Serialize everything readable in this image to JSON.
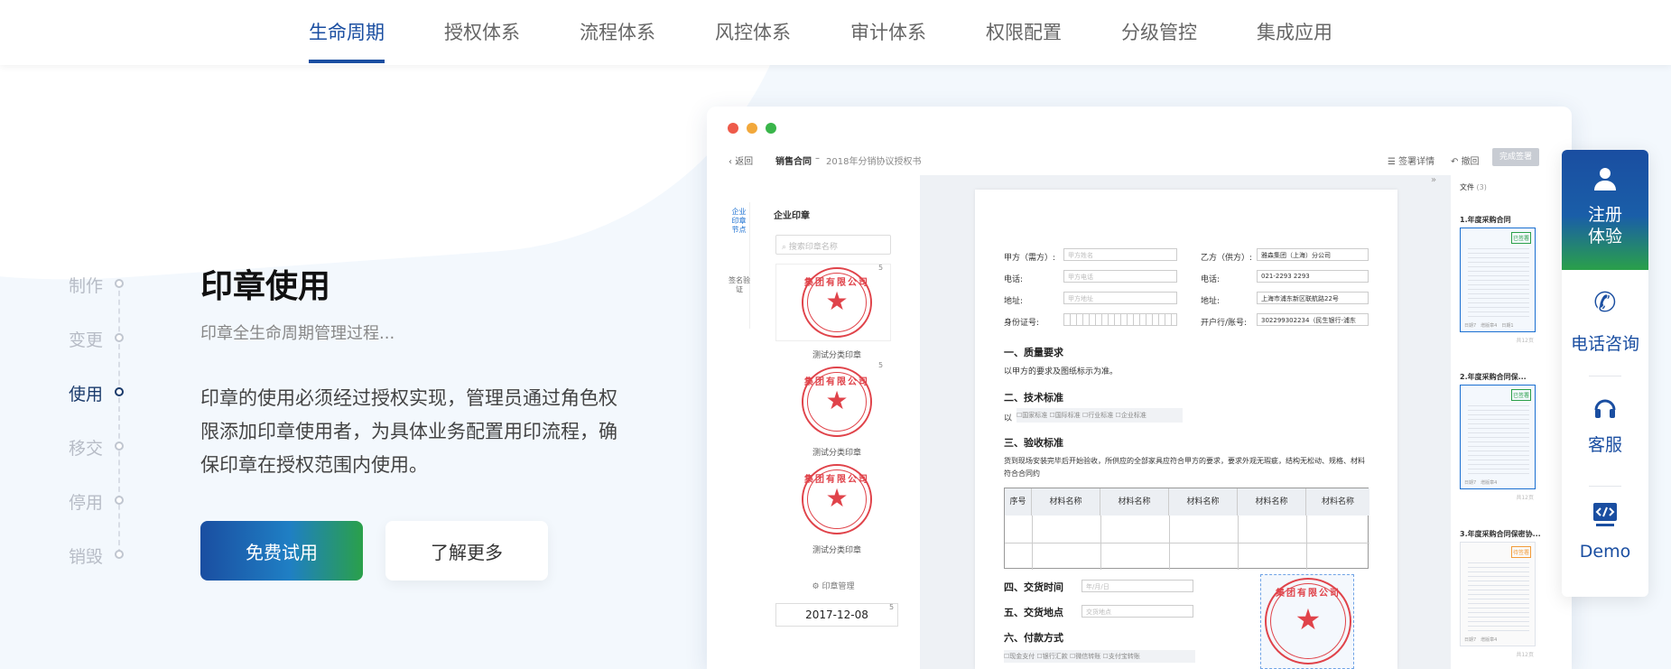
{
  "nav": {
    "tabs": [
      "生命周期",
      "授权体系",
      "流程体系",
      "风控体系",
      "审计体系",
      "权限配置",
      "分级管控",
      "集成应用"
    ],
    "active": 0
  },
  "timeline": [
    "制作",
    "变更",
    "使用",
    "移交",
    "停用",
    "销毁"
  ],
  "timeline_active": 2,
  "hero": {
    "title": "印章使用",
    "subtitle": "印章全生命周期管理过程...",
    "description": "印章的使用必须经过授权实现，管理员通过角色权限添加印章使用者，为具体业务配置用印流程，确保印章在授权范围内使用。",
    "primary_button": "免费试用",
    "secondary_button": "了解更多"
  },
  "app": {
    "back": "返回",
    "breadcrumb_main": "销售合同",
    "breadcrumb_sep": "–",
    "breadcrumb_doc": "2018年分销协议授权书",
    "sign_detail": "签署详情",
    "revoke": "撤回",
    "finish": "完成签署",
    "side_tabs": [
      "企业印章节点",
      "签名验证"
    ],
    "panel_title": "企业印章",
    "search_placeholder": "搜索印章名称",
    "stamp_text": "集团有限公司",
    "stamps": [
      {
        "label": "测试分类印章",
        "count": "5"
      },
      {
        "label": "测试分类印章",
        "count": "5"
      },
      {
        "label": "测试分类印章",
        "count": ""
      }
    ],
    "manage": "印章管理",
    "date": "2017-12-08",
    "date_count": "5",
    "files_title": "文件",
    "files_count": "(3)",
    "files": [
      {
        "name": "1.年度采购合同",
        "badge": "已签署",
        "meta": "日期7　增版章4　日期1",
        "pages": "共12页"
      },
      {
        "name": "2.年度采购合同保...",
        "badge": "已签署",
        "meta": "日期7　增版章4",
        "pages": "共12页"
      },
      {
        "name": "3.年度采购合同保密协...",
        "badge": "待签署",
        "meta": "日期7　增版章4",
        "pages": "共12页"
      }
    ]
  },
  "doc": {
    "party_a": "甲方（需方）:",
    "party_a_ph": "甲方姓名",
    "party_b": "乙方（供方）:",
    "party_b_val": "雅森集团（上海）分公司",
    "phone": "电话:",
    "phone_ph": "甲方电话",
    "phone_val": "021-2293 2293",
    "addr": "地址:",
    "addr_ph": "甲方地址",
    "addr_val": "上海市浦东新区联航路22号",
    "id": "身份证号:",
    "bank": "开户行/账号:",
    "bank_val": "302299302234（民生银行-浦东",
    "s1": "一、质量要求",
    "s1_text": "以甲方的要求及图纸标示为准。",
    "s2": "二、技术标准",
    "s2_prefix": "以",
    "s2_opts": [
      "国家标准",
      "国际标准",
      "行业标准",
      "企业标准"
    ],
    "s3": "三、验收标准",
    "s3_text": "货到现场安装完毕后开始验收，所供应的全部家具应符合甲方的要求，要求外观无瑕疵，结构无松动、规格、材料符合合同约",
    "table_headers": [
      "序号",
      "材料名称",
      "材料名称",
      "材料名称",
      "材料名称",
      "材料名称"
    ],
    "s4": "四、交货时间",
    "s4_ph": "年/月/日",
    "s5": "五、交货地点",
    "s5_ph": "交货地点",
    "s6": "六、付款方式",
    "s6_opts": [
      "现金支付",
      "银行汇款",
      "微信转账",
      "支付宝转账"
    ]
  },
  "float": {
    "register": "注册体验",
    "phone": "电话咨询",
    "service": "客服",
    "demo": "Demo"
  },
  "colors": {
    "primary": "#1a4ea1",
    "green": "#2aa04a",
    "stamp_red": "#e0434a"
  }
}
